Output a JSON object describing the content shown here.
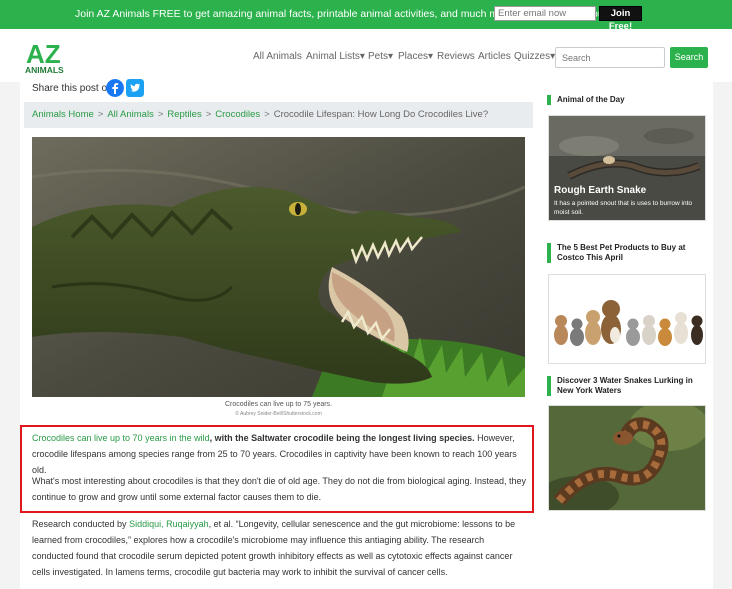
{
  "topbar": {
    "promo": "Join AZ Animals FREE to get amazing animal facts, printable animal activities, and much more sent directly to you",
    "email_placeholder": "Enter email now",
    "join_label": "Join Free!"
  },
  "nav": {
    "logo_top": "AZ",
    "logo_bottom": "ANIMALS",
    "items": [
      "All Animals",
      "Animal Lists▾",
      "Pets▾",
      "Places▾",
      "Reviews",
      "Articles",
      "Quizzes▾"
    ],
    "search_placeholder": "Search",
    "search_button": "Search"
  },
  "share": {
    "label": "Share this post on:",
    "icons": [
      "facebook-icon",
      "twitter-icon"
    ]
  },
  "breadcrumb": {
    "links": [
      "Animals Home",
      "All Animals",
      "Reptiles",
      "Crocodiles"
    ],
    "separator": ">",
    "current": "Crocodile Lifespan: How Long Do Crocodiles Live?"
  },
  "hero": {
    "caption": "Crocodiles can live up to 75 years.",
    "credit": "© Aubrey Snider-Bell/Shutterstock.com"
  },
  "article": {
    "p1_green": "Crocodiles can live up to 70 years in the wild",
    "p1_bold": ", with the Saltwater crocodile being the longest living species.",
    "p1_rest": " However, crocodile lifespans among species range from 25 to 70 years. Crocodiles in captivity have been known to reach 100 years old.",
    "p2": "What's most interesting about crocodiles is that they don't die of old age. They do not die from biological aging. Instead, they continue to grow and grow until some external factor causes them to die.",
    "p3_pre": "Research conducted by ",
    "p3_link": "Siddiqui, Ruqaiyyah",
    "p3_rest": ", et al. “Longevity, cellular senescence and the gut microbiome: lessons to be learned from crocodiles,” explores how a crocodile's microbiome may influence this antiaging ability. The research conducted found that crocodile serum depicted potent growth inhibitory effects as well as cytotoxic effects against cancer cells investigated. In lamens terms, crocodile gut bacteria may work to inhibit the survival of cancer cells."
  },
  "sidebar": {
    "aotd_header": "Animal of the Day",
    "aotd_title": "Rough Earth Snake",
    "aotd_desc": "It has a pointed snout that is uses to burrow into moist soil.",
    "card2_header": "The 5 Best Pet Products to Buy at Costco This April",
    "card3_header": "Discover 3 Water Snakes Lurking in New York Waters"
  },
  "colors": {
    "brand_green": "#2bb24c",
    "link_green": "#2a9a45",
    "highlight_red": "#e0161d"
  }
}
